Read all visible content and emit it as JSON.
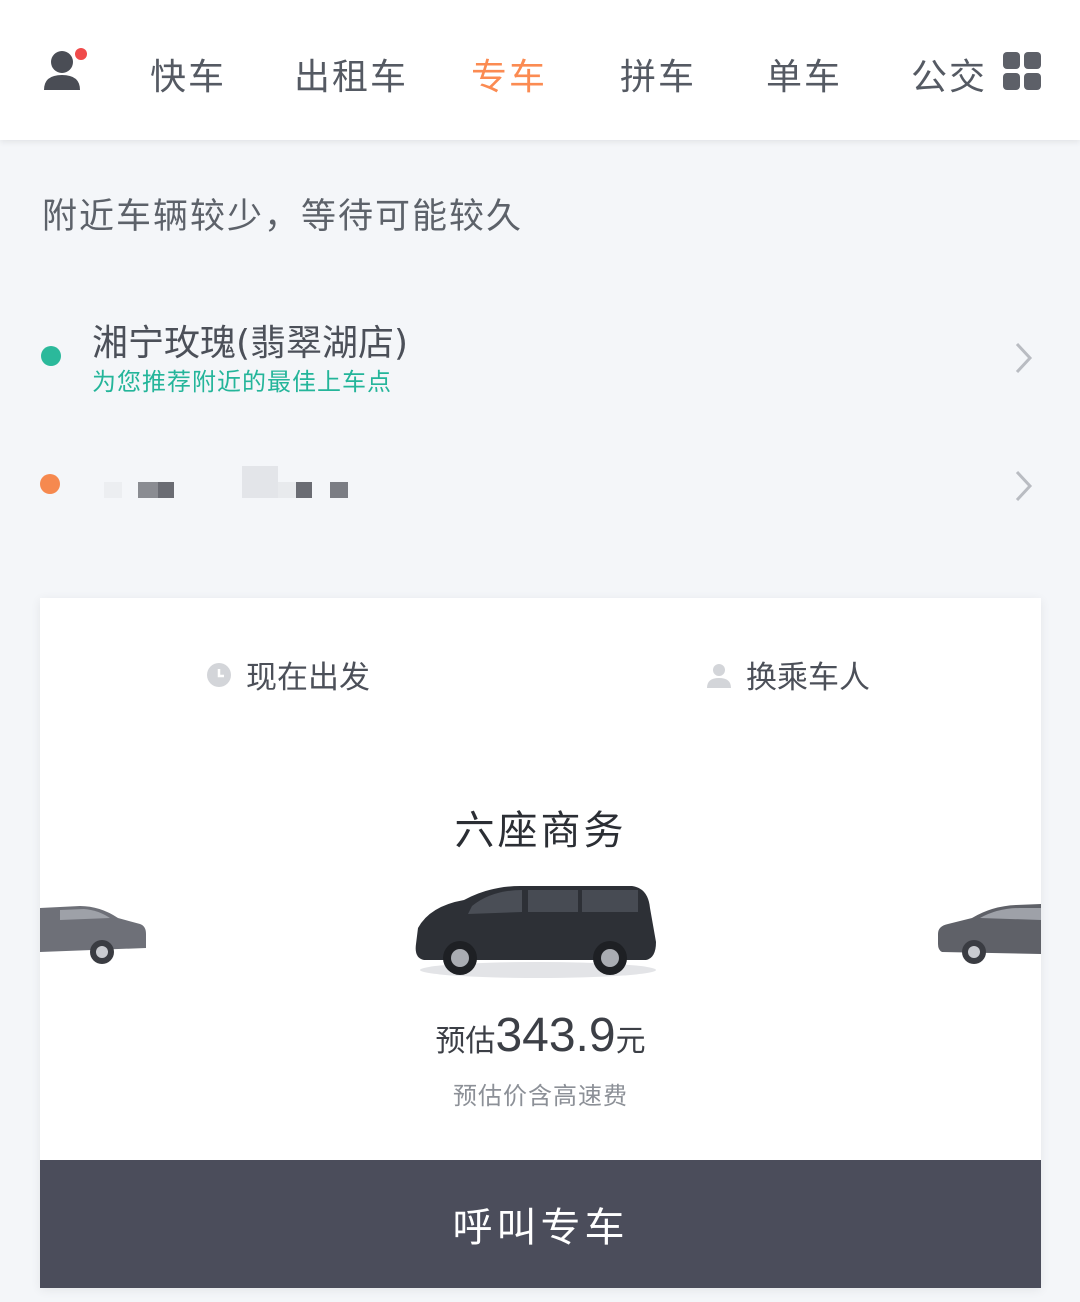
{
  "nav": {
    "tabs": [
      {
        "label": "快车"
      },
      {
        "label": "出租车"
      },
      {
        "label": "专车"
      },
      {
        "label": "拼车"
      },
      {
        "label": "单车"
      },
      {
        "label": "公交"
      }
    ],
    "active_index": 2,
    "accent_color": "#fb8b52"
  },
  "notice": "附近车辆较少，等待可能较久",
  "pickup": {
    "name": "湘宁玫瑰(翡翠湖店)",
    "hint": "为您推荐附近的最佳上车点",
    "dot_color": "#2bb99b"
  },
  "destination": {
    "dot_color": "#f6894f",
    "text_obscured": true
  },
  "card": {
    "depart_label": "现在出发",
    "passenger_label": "换乘车人",
    "car_type": "六座商务",
    "price_prefix": "预估",
    "price_value": "343.9",
    "price_unit": "元",
    "price_note": "预估价含高速费",
    "call_button": "呼叫专车"
  },
  "icons": {
    "avatar": "user-avatar-icon",
    "grid": "grid-menu-icon",
    "clock": "clock-icon",
    "person": "person-icon",
    "chevron": "chevron-right-icon"
  }
}
